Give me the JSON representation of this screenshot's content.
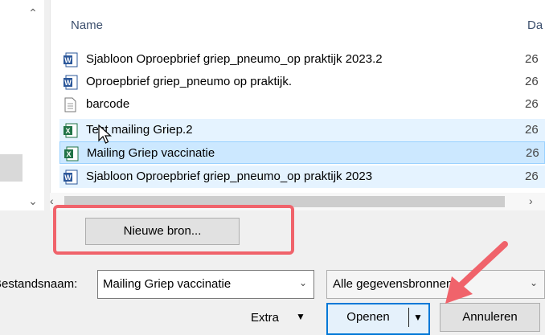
{
  "file_list": {
    "column_name": "Name",
    "column_date": "Da",
    "rows": [
      {
        "name": "Sjabloon Oproepbrief griep_pneumo_op praktijk 2023.2",
        "date": "26",
        "type": "word"
      },
      {
        "name": "Oproepbrief griep_pneumo op praktijk.",
        "date": "26",
        "type": "word"
      },
      {
        "name": "barcode",
        "date": "26",
        "type": "file"
      },
      {
        "name": "Test mailing Griep.2",
        "date": "26",
        "type": "excel"
      },
      {
        "name": "Mailing Griep vaccinatie",
        "date": "26",
        "type": "excel"
      },
      {
        "name": "Sjabloon Oproepbrief griep_pneumo_op praktijk 2023",
        "date": "26",
        "type": "word"
      }
    ]
  },
  "buttons": {
    "new_source": "Nieuwe bron...",
    "extra": "Extra",
    "open": "Openen",
    "cancel": "Annuleren"
  },
  "filename": {
    "label": "Bestandsnaam:",
    "value": "Mailing Griep vaccinatie"
  },
  "filter": {
    "value": "Alle gegevensbronnen"
  },
  "colors": {
    "highlight": "#f0636b",
    "accent": "#0078d7",
    "selected_row": "#cce8ff",
    "hover_row": "#e5f3ff"
  }
}
